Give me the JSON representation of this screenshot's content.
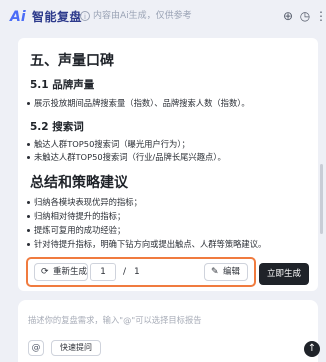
{
  "header": {
    "logo": "Ai",
    "title": "智能复盘",
    "notice": "内容由Ai生成，仅供参考",
    "buttons": {
      "add_icon": "plus-circle-icon",
      "history_icon": "clock-icon",
      "more_icon": "ellipsis-icon"
    }
  },
  "content": {
    "section5_title": "五、声量口碑",
    "s51_title": "5.1 品牌声量",
    "s51_items": [
      "展示投放期间品牌搜索量（指数）、品牌搜索人数（指数）。"
    ],
    "s52_title": "5.2 搜索词",
    "s52_items": [
      "触达人群TOP50搜索词（曝光用户行为）；",
      "未触达人群TOP50搜索词（行业/品牌长尾兴趣点）。"
    ],
    "summary_title": "总结和策略建议",
    "summary_items": [
      "归纳各模块表现优异的指标；",
      "归纳相对待提升的指标；",
      "提炼可复用的成功经验；",
      "针对待提升指标，明确下钻方向或提出触点、人群等策略建议。"
    ]
  },
  "actions": {
    "regenerate_label": "重新生成",
    "regenerate_icon": "refresh-icon",
    "page_current": "1",
    "page_sep": "/",
    "page_total": "1",
    "edit_label": "编辑",
    "edit_icon": "pencil-icon",
    "generate_label": "立即生成",
    "highlight_color": "#f07b3f"
  },
  "composer": {
    "placeholder": "描述你的复盘需求，输入\"@\"可以选择目标报告",
    "at_label": "@",
    "quick_label": "快速提问",
    "send_icon": "arrow-up-icon"
  },
  "colors": {
    "accent": "#4a6cf7",
    "dark_button": "#1f2329"
  }
}
